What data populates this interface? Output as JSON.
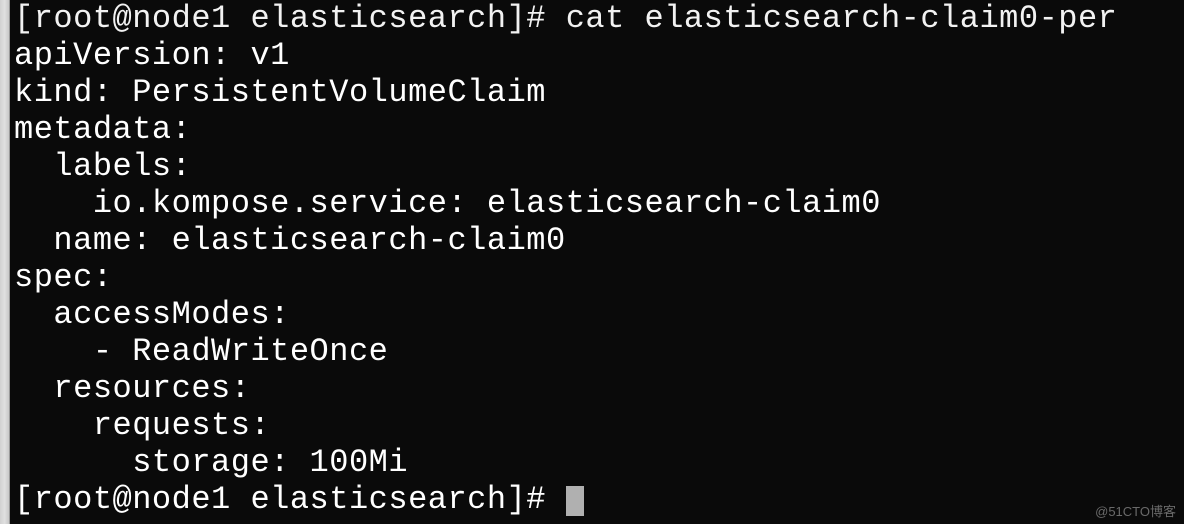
{
  "terminal": {
    "lines": [
      "[root@node1 elasticsearch]# cat elasticsearch-claim0-per",
      "apiVersion: v1",
      "kind: PersistentVolumeClaim",
      "metadata:",
      "  labels:",
      "    io.kompose.service: elasticsearch-claim0",
      "  name: elasticsearch-claim0",
      "spec:",
      "  accessModes:",
      "    - ReadWriteOnce",
      "  resources:",
      "    requests:",
      "      storage: 100Mi"
    ],
    "prompt": "[root@node1 elasticsearch]# "
  },
  "watermark": "@51CTO博客"
}
